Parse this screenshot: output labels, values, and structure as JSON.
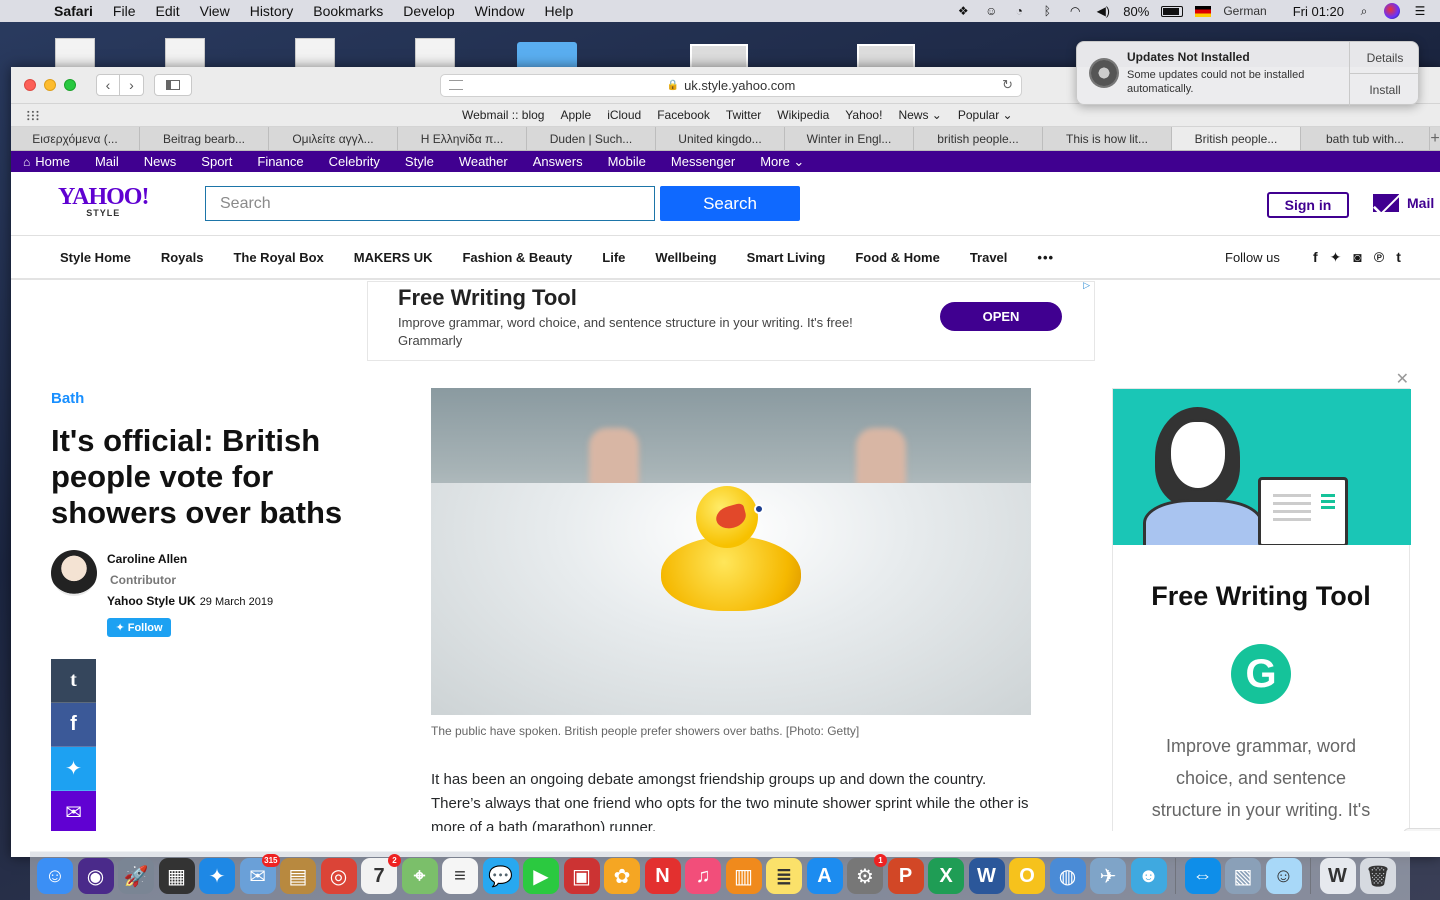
{
  "menubar": {
    "app_name": "Safari",
    "menus": [
      "File",
      "Edit",
      "View",
      "History",
      "Bookmarks",
      "Develop",
      "Window",
      "Help"
    ],
    "battery_percent": "80%",
    "input_language": "German",
    "clock": "Fri 01:20"
  },
  "notification": {
    "title": "Updates Not Installed",
    "body": "Some updates could not be installed automatically.",
    "details_label": "Details",
    "install_label": "Install"
  },
  "browser": {
    "url": "uk.style.yahoo.com",
    "favorites": [
      "Webmail :: blog",
      "Apple",
      "iCloud",
      "Facebook",
      "Twitter",
      "Wikipedia",
      "Yahoo!",
      "News ⌄",
      "Popular ⌄"
    ],
    "tabs": [
      {
        "label": "Εισερχόμενα (..."
      },
      {
        "label": "Beitrag bearb..."
      },
      {
        "label": "Ομιλείτε αγγλ..."
      },
      {
        "label": "Η Ελληνίδα π..."
      },
      {
        "label": "Duden | Such..."
      },
      {
        "label": "United kingdo..."
      },
      {
        "label": "Winter in Engl..."
      },
      {
        "label": "british people..."
      },
      {
        "label": "This is how lit..."
      },
      {
        "label": "British people..."
      },
      {
        "label": "bath tub with..."
      }
    ],
    "active_tab_index": 9
  },
  "yahoo_nav": [
    "Home",
    "Mail",
    "News",
    "Sport",
    "Finance",
    "Celebrity",
    "Style",
    "Weather",
    "Answers",
    "Mobile",
    "Messenger",
    "More ⌄"
  ],
  "header": {
    "logo_text": "YAHOO!",
    "logo_sub": "STYLE",
    "search_placeholder": "Search",
    "search_button": "Search",
    "signin_label": "Sign in",
    "mail_label": "Mail"
  },
  "categories": [
    "Style Home",
    "Royals",
    "The Royal Box",
    "MAKERS UK",
    "Fashion & Beauty",
    "Life",
    "Wellbeing",
    "Smart Living",
    "Food & Home",
    "Travel",
    "•••"
  ],
  "follow_label": "Follow us",
  "social_icons": [
    "facebook-icon",
    "twitter-icon",
    "instagram-icon",
    "pinterest-icon",
    "tumblr-icon"
  ],
  "top_ad": {
    "title": "Free Writing Tool",
    "description": "Improve grammar, word choice, and sentence structure in your writing. It's free!",
    "brand": "Grammarly",
    "cta": "OPEN"
  },
  "article": {
    "category": "Bath",
    "headline": "It's official: British people vote for showers over baths",
    "author_name": "Caroline Allen",
    "author_role": "Contributor",
    "publisher": "Yahoo Style UK",
    "date": "29 March 2019",
    "follow_label": "Follow",
    "caption": "The public have spoken. British people prefer showers over baths. [Photo: Getty]",
    "body": "It has been an ongoing debate amongst friendship groups up and down the country. There’s always that one friend who opts for the two minute shower sprint while the other is more of a bath (marathon) runner."
  },
  "side_ad": {
    "title": "Free Writing Tool",
    "description": "Improve grammar, word choice, and sentence structure in your writing. It's free!"
  },
  "dock": {
    "apps": [
      {
        "name": "finder-icon",
        "color": "#3b8ff5",
        "glyph": "☺"
      },
      {
        "name": "siri-icon",
        "color": "#4a2a8a",
        "glyph": "◉"
      },
      {
        "name": "launchpad-icon",
        "color": "#7a8594",
        "glyph": "🚀"
      },
      {
        "name": "photo-booth-icon",
        "color": "#333",
        "glyph": "▦"
      },
      {
        "name": "safari-icon",
        "color": "#1e88e5",
        "glyph": "✦"
      },
      {
        "name": "mail-icon",
        "color": "#6aa0d8",
        "glyph": "✉",
        "badge": "315"
      },
      {
        "name": "notefile-icon",
        "color": "#b8893f",
        "glyph": "▤"
      },
      {
        "name": "chrome-icon",
        "color": "#db4437",
        "glyph": "◎"
      },
      {
        "name": "calendar-icon",
        "color": "#f2f2f2",
        "glyph": "7",
        "badge": "2"
      },
      {
        "name": "maps-icon",
        "color": "#7bbf6a",
        "glyph": "⌖"
      },
      {
        "name": "reminders-icon",
        "color": "#f5f5f5",
        "glyph": "≡"
      },
      {
        "name": "messages-icon",
        "color": "#28a8f0",
        "glyph": "💬"
      },
      {
        "name": "facetime-icon",
        "color": "#2bc940",
        "glyph": "▶"
      },
      {
        "name": "photo-slideshow-icon",
        "color": "#c33",
        "glyph": "▣"
      },
      {
        "name": "photos-icon",
        "color": "#f5a623",
        "glyph": "✿"
      },
      {
        "name": "news-icon",
        "color": "#e3302f",
        "glyph": "N"
      },
      {
        "name": "itunes-icon",
        "color": "#f24e7a",
        "glyph": "♫"
      },
      {
        "name": "books-icon",
        "color": "#f08a1c",
        "glyph": "▥"
      },
      {
        "name": "notes-icon",
        "color": "#fbe16a",
        "glyph": "≣"
      },
      {
        "name": "app-store-icon",
        "color": "#1c8cf0",
        "glyph": "A"
      },
      {
        "name": "system-preferences-icon",
        "color": "#777",
        "glyph": "⚙",
        "badge": "1"
      },
      {
        "name": "powerpoint-icon",
        "color": "#d24726",
        "glyph": "P"
      },
      {
        "name": "excel-icon",
        "color": "#1f9d55",
        "glyph": "X"
      },
      {
        "name": "word-icon",
        "color": "#2b579a",
        "glyph": "W"
      },
      {
        "name": "outlook-icon",
        "color": "#f6c21c",
        "glyph": "O"
      },
      {
        "name": "network-icon",
        "color": "#4a8bd6",
        "glyph": "◍"
      },
      {
        "name": "image-capture-icon",
        "color": "#7fa4c8",
        "glyph": "✈"
      },
      {
        "name": "contacts-group-icon",
        "color": "#3fa9e0",
        "glyph": "☻"
      },
      {
        "name": "teamviewer-icon",
        "color": "#0e8ee9",
        "glyph": "⇔"
      },
      {
        "name": "preview-icon",
        "color": "#8aa0b8",
        "glyph": "▧"
      },
      {
        "name": "finder-face-icon",
        "color": "#a8d8f8",
        "glyph": "☺"
      },
      {
        "name": "word-document-icon",
        "color": "#e6e9ee",
        "glyph": "W"
      },
      {
        "name": "trash-icon",
        "color": "#d6dae0",
        "glyph": "🗑"
      }
    ]
  }
}
